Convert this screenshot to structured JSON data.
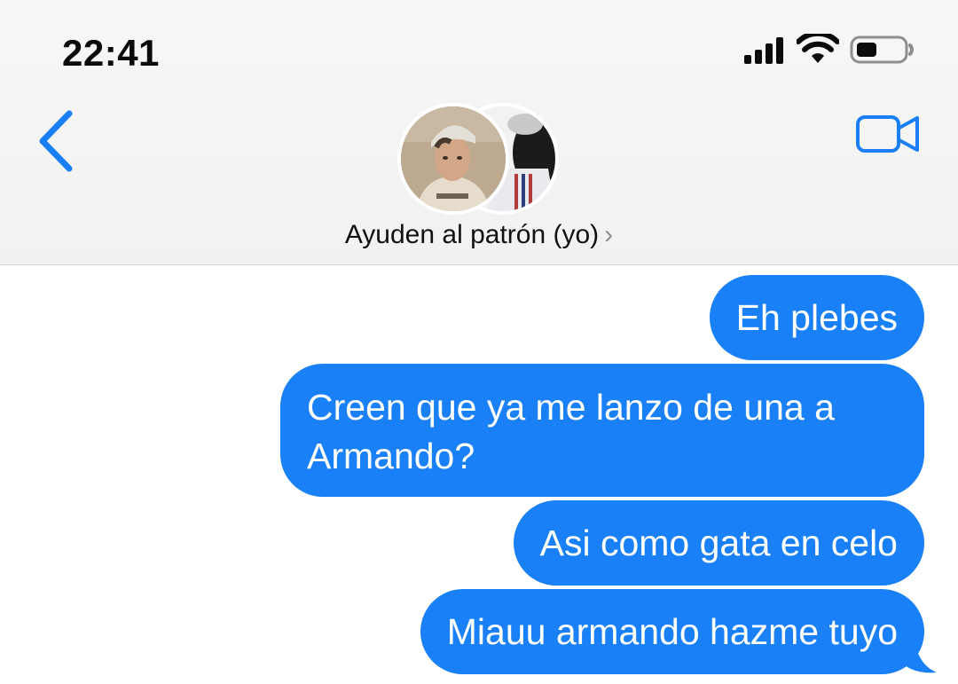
{
  "status_bar": {
    "time": "22:41",
    "signal_icon": "cellular-signal-icon",
    "wifi_icon": "wifi-icon",
    "battery_icon": "battery-icon"
  },
  "header": {
    "back_icon": "chevron-left-icon",
    "video_icon": "video-camera-icon",
    "group_name": "Ayuden al patrón (yo)",
    "group_chevron": "›"
  },
  "messages": [
    {
      "sender": "me",
      "text": "Eh plebes"
    },
    {
      "sender": "me",
      "text": "Creen que ya me lanzo de una a Armando?"
    },
    {
      "sender": "me",
      "text": "Asi como gata en celo"
    },
    {
      "sender": "me",
      "text": "Miauu armando hazme tuyo"
    }
  ],
  "colors": {
    "accent": "#1a80f7",
    "bubble_text": "#ffffff",
    "header_bg": "#f4f4f3"
  }
}
